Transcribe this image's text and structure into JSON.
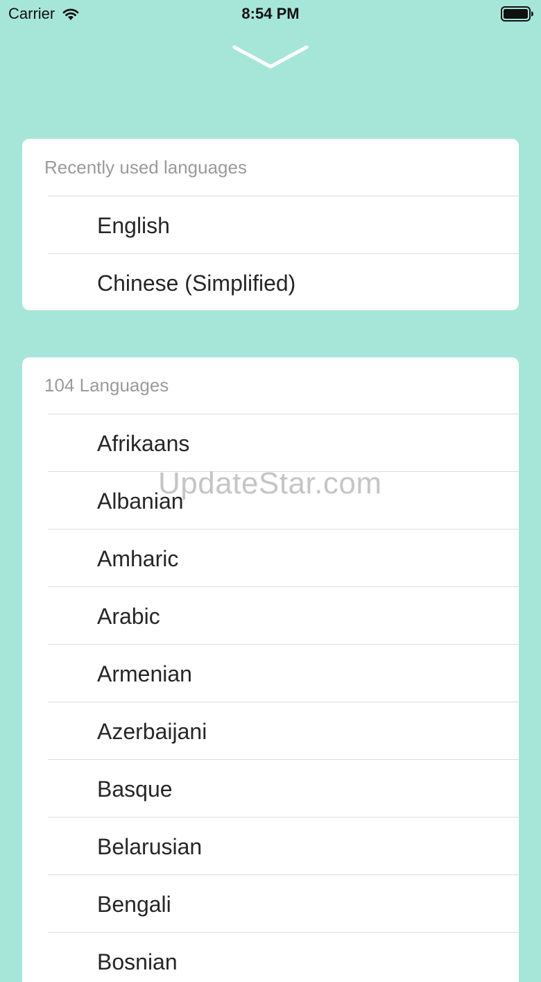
{
  "status_bar": {
    "carrier": "Carrier",
    "time": "8:54 PM"
  },
  "recent": {
    "header": "Recently used languages",
    "items": [
      "English",
      "Chinese (Simplified)"
    ]
  },
  "all": {
    "header": "104 Languages",
    "items": [
      "Afrikaans",
      "Albanian",
      "Amharic",
      "Arabic",
      "Armenian",
      "Azerbaijani",
      "Basque",
      "Belarusian",
      "Bengali",
      "Bosnian"
    ]
  },
  "watermark": "UpdateStar.com",
  "colors": {
    "background": "#a6e6d8",
    "card": "#ffffff",
    "header_text": "#9a9a9a",
    "item_text": "#262626"
  },
  "icons": [
    "wifi-icon",
    "battery-icon",
    "chevron-down-icon"
  ]
}
